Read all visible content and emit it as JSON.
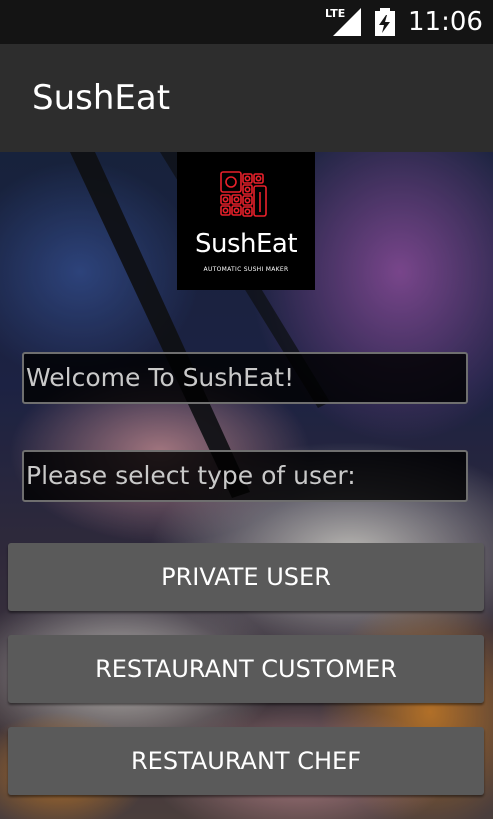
{
  "status_bar": {
    "network_label": "LTE",
    "network_icon": "signal-icon",
    "battery_icon": "battery-charging-icon",
    "time": "11:06"
  },
  "action_bar": {
    "title": "SushEat"
  },
  "logo": {
    "icon": "sushi-grid-icon",
    "brand": "SushEat",
    "tagline": "AUTOMATIC SUSHI MAKER",
    "accent_color": "#e8202a"
  },
  "fields": {
    "welcome": "Welcome To SushEat!",
    "prompt": "Please select type of user:"
  },
  "buttons": {
    "private_user": "PRIVATE USER",
    "restaurant_customer": "RESTAURANT CUSTOMER",
    "restaurant_chef": "RESTAURANT CHEF"
  },
  "colors": {
    "status_bar_bg": "#141414",
    "action_bar_bg": "#2d2d2d",
    "button_bg": "#5a5a5a",
    "field_border": "#6f6f6f"
  }
}
